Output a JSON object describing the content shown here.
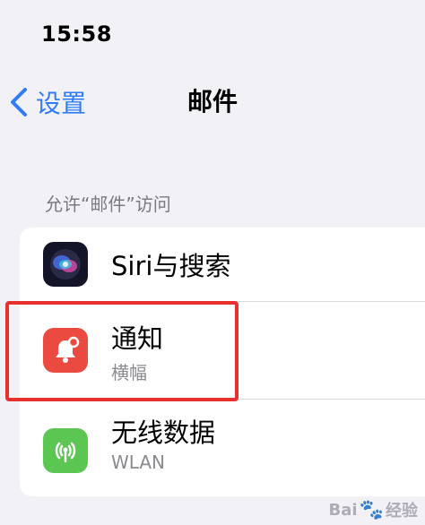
{
  "status_bar": {
    "time": "15:58"
  },
  "nav": {
    "back_label": "设置",
    "title": "邮件"
  },
  "section": {
    "header": "允许“邮件”访问"
  },
  "rows": [
    {
      "title": "Siri与搜索",
      "subtitle": "",
      "icon": "siri-icon",
      "icon_color": "#1b1b2e"
    },
    {
      "title": "通知",
      "subtitle": "横幅",
      "icon": "bell-notification-icon",
      "icon_color": "#ea4a3f"
    },
    {
      "title": "无线数据",
      "subtitle": "WLAN",
      "icon": "antenna-signal-icon",
      "icon_color": "#5cc652"
    }
  ],
  "watermark": {
    "text_left": "Bai",
    "text_right": "经验"
  },
  "colors": {
    "accent": "#2f7cf6",
    "highlight": "#e8302f",
    "background": "#f2f2f6"
  }
}
